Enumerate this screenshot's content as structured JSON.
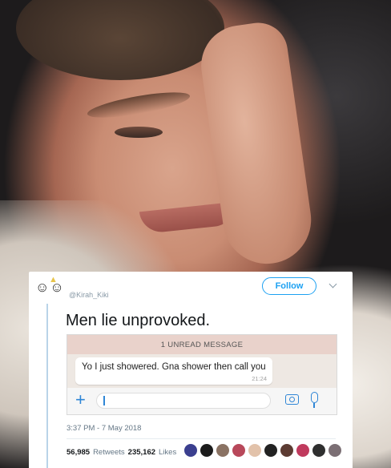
{
  "tweet": {
    "handle": "@Kirah_Kiki",
    "follow_label": "Follow",
    "text": "Men lie unprovoked.",
    "timestamp": "3:37 PM - 7 May 2018",
    "retweets_count": "56,985",
    "retweets_label": "Retweets",
    "likes_count": "235,162",
    "likes_label": "Likes",
    "avatar_icon": "stylized-faces-icon",
    "liker_avatar_colors": [
      "#3b3f8f",
      "#1b1b1b",
      "#8a7263",
      "#b8485a",
      "#e2c2aa",
      "#222222",
      "#5c3b32",
      "#c03a5d",
      "#2f2f2f",
      "#7b6f74"
    ]
  },
  "chat": {
    "unread_banner": "1 UNREAD MESSAGE",
    "message": "Yo I just showered. Gna shower then call you",
    "message_time": "21:24",
    "plus_icon": "+",
    "icons": [
      "plus-icon",
      "camera-icon",
      "mic-icon"
    ]
  },
  "colors": {
    "accent": "#1da1f2",
    "chat_accent": "#2f86d6",
    "unread_banner_bg": "#e9d2cb"
  }
}
